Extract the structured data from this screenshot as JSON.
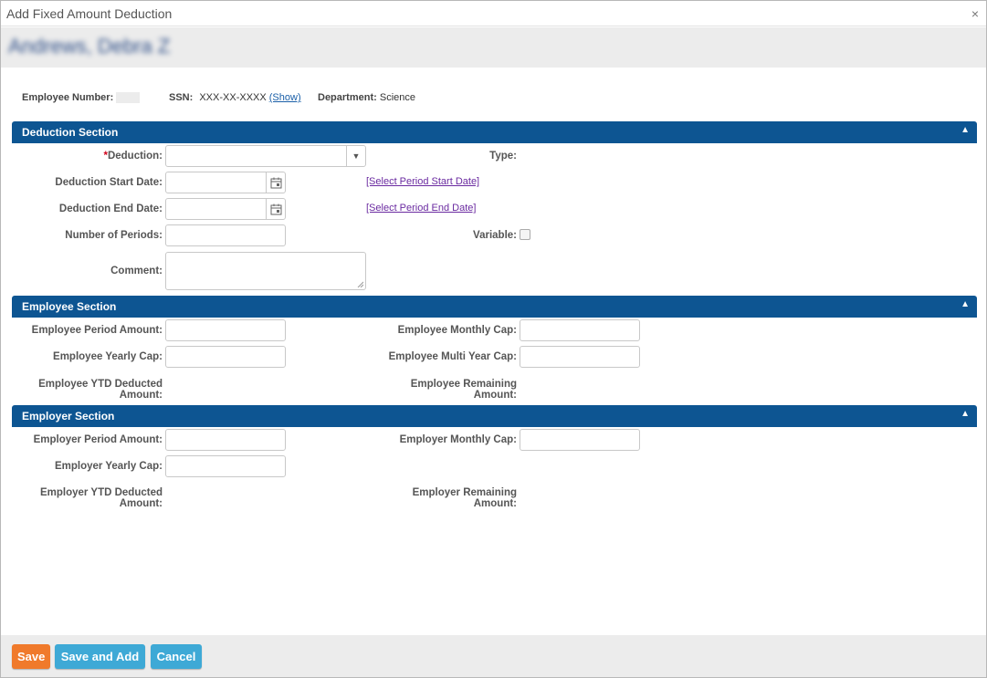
{
  "dialog": {
    "title": "Add Fixed Amount Deduction",
    "close": "×"
  },
  "employee": {
    "name": "Andrews, Debra Z",
    "number_label": "Employee Number:",
    "ssn_label": "SSN:",
    "ssn_value": "XXX-XX-XXXX",
    "ssn_show": "(Show)",
    "department_label": "Department:",
    "department_value": "Science"
  },
  "deduction_section": {
    "title": "Deduction Section",
    "toggle": "▲",
    "required_mark": "*",
    "deduction_label": "Deduction:",
    "deduction_value": "",
    "type_label": "Type:",
    "start_date_label": "Deduction Start Date:",
    "start_date_value": "",
    "select_start_link": "[Select Period Start Date]",
    "end_date_label": "Deduction End Date:",
    "end_date_value": "",
    "select_end_link": "[Select Period End Date]",
    "periods_label": "Number of Periods:",
    "periods_value": "",
    "variable_label": "Variable:",
    "comment_label": "Comment:",
    "comment_value": ""
  },
  "employee_section": {
    "title": "Employee Section",
    "toggle": "▲",
    "period_amount_label": "Employee Period Amount:",
    "monthly_cap_label": "Employee Monthly Cap:",
    "yearly_cap_label": "Employee Yearly Cap:",
    "multi_year_cap_label": "Employee Multi Year Cap:",
    "ytd_label_1": "Employee YTD Deducted",
    "ytd_label_2": "Amount:",
    "remaining_label_1": "Employee Remaining",
    "remaining_label_2": "Amount:"
  },
  "employer_section": {
    "title": "Employer Section",
    "toggle": "▲",
    "period_amount_label": "Employer Period Amount:",
    "monthly_cap_label": "Employer Monthly Cap:",
    "yearly_cap_label": "Employer Yearly Cap:",
    "ytd_label_1": "Employer YTD Deducted",
    "ytd_label_2": "Amount:",
    "remaining_label_1": "Employer Remaining",
    "remaining_label_2": "Amount:"
  },
  "footer": {
    "save": "Save",
    "save_and_add": "Save and Add",
    "cancel": "Cancel"
  },
  "colors": {
    "section_header": "#0d5592",
    "save_button": "#f07a2b",
    "secondary_button": "#3ea9d6"
  }
}
